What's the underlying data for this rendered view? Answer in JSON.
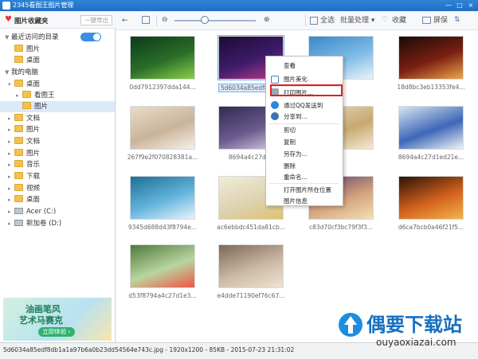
{
  "title_bar": {
    "title": "2345看图王图片管理",
    "minimize": "—",
    "maximize": "□",
    "close": "×"
  },
  "sidebar": {
    "header": "图片收藏夹",
    "export_label": "一键导出",
    "recent_label": "最近访问的目录",
    "recent_items": [
      "图片",
      "桌面"
    ],
    "computer_label": "我的电脑",
    "tree": [
      "桌面",
      "看图王",
      "图片",
      "文档",
      "图片",
      "文档",
      "图片",
      "音乐",
      "下载",
      "视频",
      "桌面",
      "Acer (C:)",
      "新加卷 (D:)"
    ]
  },
  "ad": {
    "line1": "油画笔风",
    "line2": "艺术马赛克",
    "button": "立即体验 ›"
  },
  "toolbar": {
    "select_all": "全选",
    "batch": "批量处理 ▾",
    "favorite": "收藏",
    "screen": "屏保",
    "back": "←",
    "forward": "→",
    "zoom_out": "⊖",
    "zoom_in": "⊕",
    "sort": "⇅"
  },
  "thumbnails": [
    {
      "caption": "0dd7912397dda144...",
      "colors": [
        "#0d3b1a",
        "#2a6d28",
        "#8bd04a"
      ]
    },
    {
      "caption": "5d6034a85edf8",
      "colors": [
        "#1b0b33",
        "#3f1c6b",
        "#c23a8a"
      ]
    },
    {
      "caption": "",
      "colors": [
        "#3a88c8",
        "#7fbce6",
        "#eaf3f9"
      ]
    },
    {
      "caption": "18d8bc3eb13353fe4...",
      "colors": [
        "#1a0b08",
        "#7a2012",
        "#f0a54a"
      ]
    },
    {
      "caption": "267f9e2f070828381a...",
      "colors": [
        "#e9dcc9",
        "#c9b49a",
        "#f6f1e8"
      ]
    },
    {
      "caption": "8694a4c27d1e",
      "colors": [
        "#2f2d50",
        "#6b5a8e",
        "#ddd2e8"
      ]
    },
    {
      "caption": "",
      "colors": [
        "#e9dcc0",
        "#c8a870",
        "#f3e9d0"
      ]
    },
    {
      "caption": "8694a4c27d1ed21e...",
      "colors": [
        "#d6e5ef",
        "#3e67b8",
        "#f0f4f8"
      ]
    },
    {
      "caption": "9345d688d43f8794e...",
      "colors": [
        "#1c6f96",
        "#64b5dd",
        "#e8f4fa"
      ]
    },
    {
      "caption": "ac6ebbdc451da81cb...",
      "colors": [
        "#f1ecd8",
        "#dcd3b0",
        "#e0c070"
      ]
    },
    {
      "caption": "c83d70cf3bc79f3f3...",
      "colors": [
        "#5b3e70",
        "#d3a27c",
        "#f4e0b3"
      ]
    },
    {
      "caption": "d6ca7bcb0a46f21f5...",
      "colors": [
        "#2a1408",
        "#d2611d",
        "#f6b34b"
      ]
    },
    {
      "caption": "d53f8794a4c27d1e3...",
      "colors": [
        "#4f7a3a",
        "#b9d5a0",
        "#e54"
      ]
    },
    {
      "caption": "e4dde71190ef76c67...",
      "colors": [
        "#7b6857",
        "#cbb9a4",
        "#efe3d2"
      ]
    }
  ],
  "highlighted_caption": "5d6034a85edf8",
  "context_menu": [
    "查看",
    "图片美化",
    "打印图片...",
    "通过QQ发送到",
    "分享到...",
    "剪切",
    "复制",
    "另存为...",
    "删除",
    "重命名...",
    "打开图片所在位置",
    "图片信息"
  ],
  "status": "5d6034a85edf8db1a1a97b6a0b23dd54564e743c.jpg - 1920x1200 - 85KB - 2015-07-23 21:31:02",
  "watermark": {
    "cn": "偶要下载站",
    "en": "ouyaoxiazai.com"
  },
  "accent_color": "#2f84d8"
}
